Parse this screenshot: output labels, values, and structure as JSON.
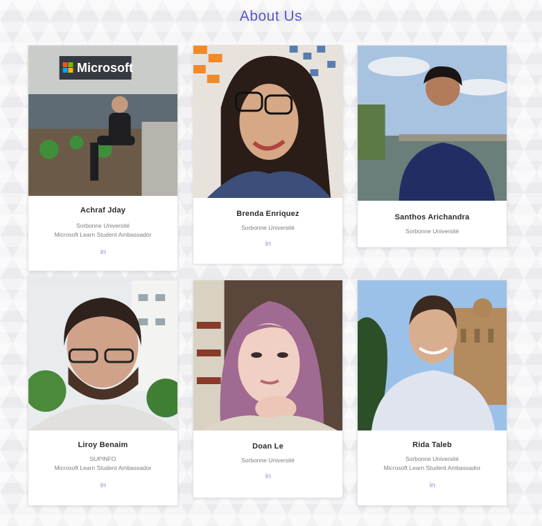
{
  "page": {
    "title": "About Us"
  },
  "members": [
    {
      "name": "Achraf Jday",
      "lines": [
        "Sorbonne Université",
        "Microsoft Learn Student Ambassador"
      ],
      "link_icon": "linkedin-icon",
      "photo_sign": "Microsoft"
    },
    {
      "name": "Brenda Enriquez",
      "lines": [
        "Sorbonne Université"
      ],
      "link_icon": "linkedin-icon"
    },
    {
      "name": "Santhos Arichandra",
      "lines": [
        "Sorbonne Université"
      ]
    },
    {
      "name": "Liroy Benaim",
      "lines": [
        "SUPINFO",
        "Microsoft Learn Student Ambassador"
      ],
      "link_icon": "linkedin-icon"
    },
    {
      "name": "Doan Le",
      "lines": [
        "Sorbonne Université"
      ],
      "link_icon": "linkedin-icon"
    },
    {
      "name": "Rida Taleb",
      "lines": [
        "Sorbonne Université",
        "Microsoft Learn Student Ambassador"
      ],
      "link_icon": "linkedin-icon"
    }
  ],
  "icons": {
    "linkedin_glyph": "in"
  },
  "colors": {
    "accent": "#5b57c9",
    "link": "#b3b0e8"
  }
}
